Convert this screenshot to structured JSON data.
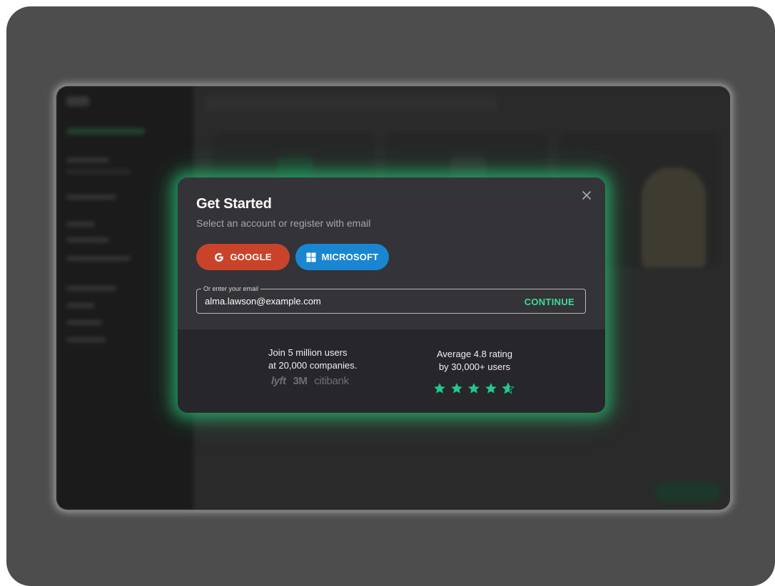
{
  "modal": {
    "title": "Get Started",
    "subtitle": "Select an account or register with email",
    "google_label": "GOOGLE",
    "microsoft_label": "MICROSOFT",
    "email_legend": "Or enter your email",
    "email_value": "alma.lawson@example.com",
    "continue_label": "CONTINUE"
  },
  "stats": {
    "users_line1": "Join 5 million users",
    "users_line2": "at 20,000 companies.",
    "rating_line1": "Average 4.8 rating",
    "rating_line2": "by 30,000+ users",
    "rating_value": 4.8,
    "rating_max": 5,
    "logos": [
      "lyft",
      "3M",
      "citibank"
    ]
  },
  "colors": {
    "google": "#c8432a",
    "microsoft": "#1a85d0",
    "accent_green": "#3ddc97",
    "star_green": "#1fc98a"
  },
  "icons": {
    "close": "close-icon",
    "google": "google-icon",
    "microsoft": "windows-icon",
    "star": "star-icon"
  }
}
